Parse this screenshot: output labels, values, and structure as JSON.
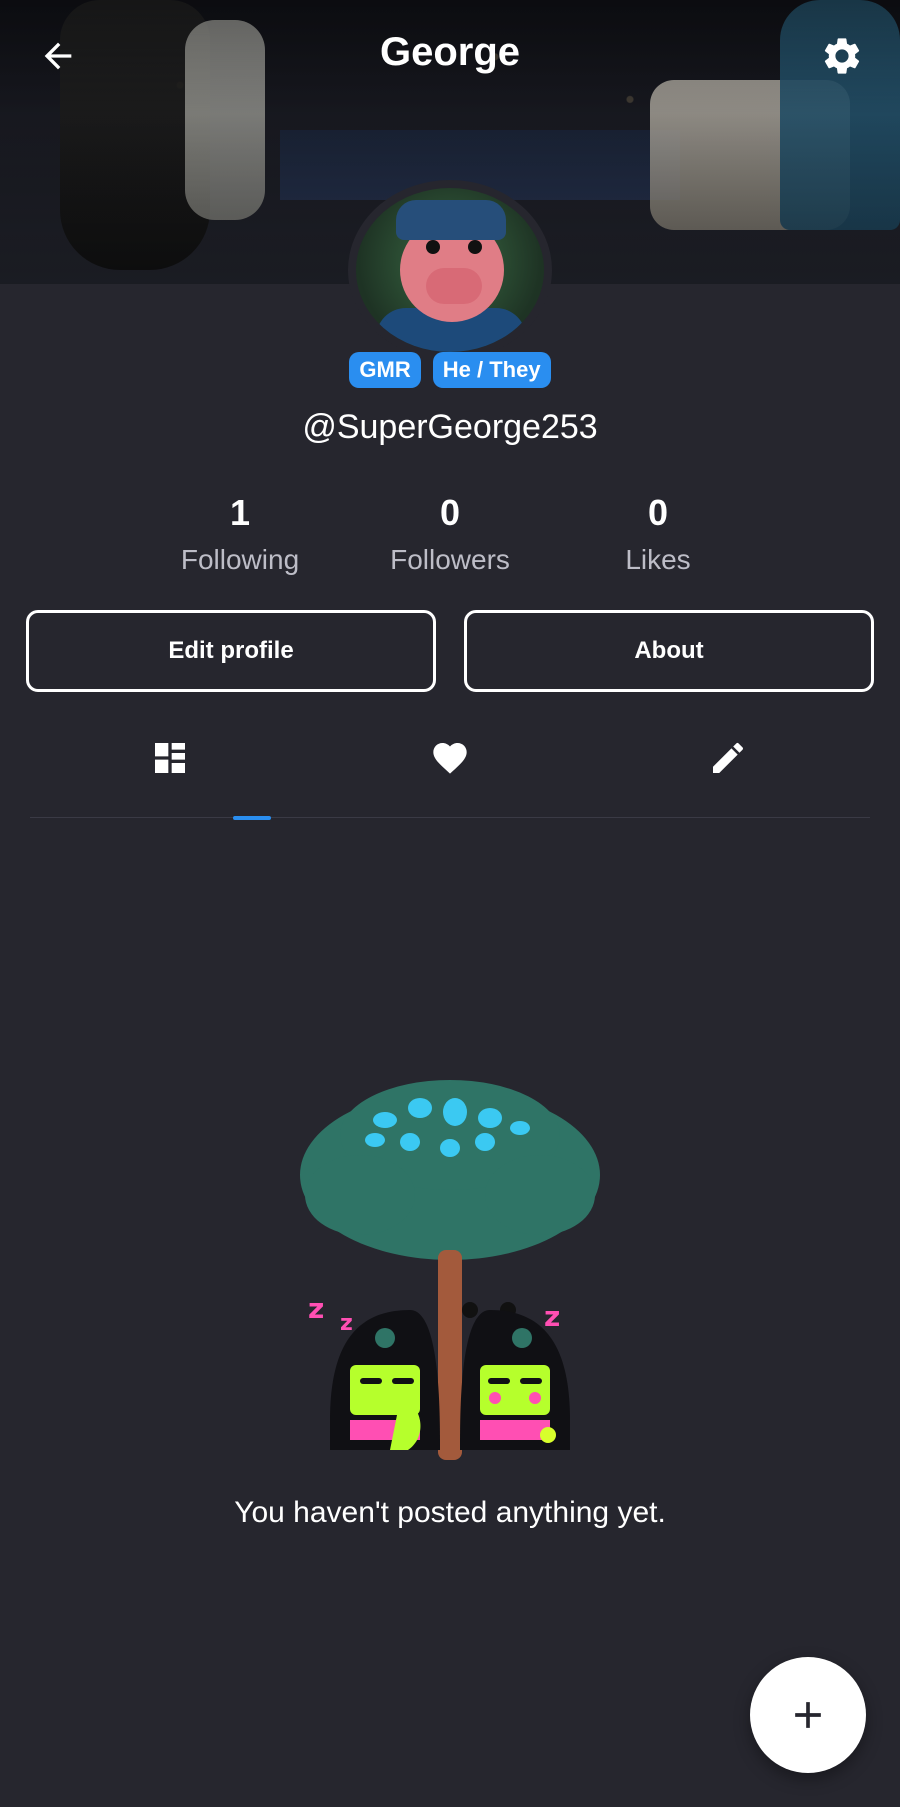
{
  "header": {
    "title": "George",
    "back_icon": "arrow-left-icon",
    "settings_icon": "gear-icon"
  },
  "profile": {
    "badges": [
      "GMR",
      "He / They"
    ],
    "handle": "@SuperGeorge253"
  },
  "stats": {
    "following": {
      "value": "1",
      "label": "Following"
    },
    "followers": {
      "value": "0",
      "label": "Followers"
    },
    "likes": {
      "value": "0",
      "label": "Likes"
    }
  },
  "actions": {
    "edit_profile": "Edit profile",
    "about": "About"
  },
  "tabs": [
    {
      "icon": "grid-layout-icon",
      "active": true
    },
    {
      "icon": "heart-icon",
      "active": false
    },
    {
      "icon": "pencil-icon",
      "active": false
    }
  ],
  "empty_state": {
    "message": "You haven't posted anything yet."
  },
  "fab": {
    "icon": "plus-icon"
  },
  "colors": {
    "background": "#26262e",
    "accent": "#2a8ef0",
    "text_secondary": "#bdbdc7"
  }
}
